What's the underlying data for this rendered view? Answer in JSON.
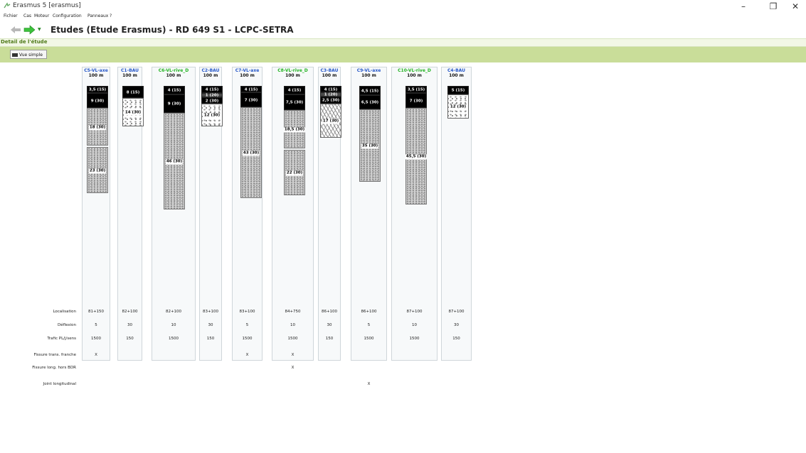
{
  "window": {
    "title": "Erasmus 5 [erasmus]",
    "controls": {
      "minimize": "–",
      "restore": "❐",
      "close": "✕"
    }
  },
  "menu": [
    "Fichier",
    "Cas",
    "Moteur",
    "Configuration",
    "Panneaux",
    "?"
  ],
  "nav": {
    "title": "Etudes (Etude Erasmus) - RD 649 S1 - LCPC-SETRA"
  },
  "section": {
    "title": "Detail de l'étude"
  },
  "toolbar": {
    "view_button": "Vue simple"
  },
  "colors": {
    "blue_name": "#2456c8",
    "green_name": "#22b322",
    "toolbar_bg": "#c9dd99"
  },
  "columns": [
    {
      "name": "C5-VL-axe",
      "name_color": "blue",
      "length": "100 m",
      "layers": [
        {
          "label": "3,5 (15)",
          "type": "black",
          "h": 10
        },
        {
          "label": "9 (30)",
          "type": "black",
          "h": 21
        },
        {
          "label": "18 (30)",
          "type": "gravel",
          "h": 53
        },
        {
          "label": "23 (30)",
          "type": "gravel",
          "h": 65
        }
      ]
    },
    {
      "name": "C1-BAU",
      "name_color": "blue",
      "length": "100 m",
      "layers": [
        {
          "label": "8 (15)",
          "type": "black",
          "h": 17
        },
        {
          "label": "14 (30)",
          "type": "white",
          "h": 40
        }
      ]
    },
    {
      "name": "C6-VL-rive_D",
      "name_color": "green",
      "length": "100 m",
      "layers": [
        {
          "label": "4 (15)",
          "type": "black",
          "h": 12
        },
        {
          "label": "9 (30)",
          "type": "black",
          "h": 26
        },
        {
          "label": "46 (30)",
          "type": "gravel",
          "h": 136
        }
      ]
    },
    {
      "name": "C2-BAU",
      "name_color": "blue",
      "length": "100 m",
      "layers": [
        {
          "label": "4 (15)",
          "type": "black",
          "h": 10
        },
        {
          "label": "1 (20)",
          "type": "dgray",
          "h": 6
        },
        {
          "label": "2 (30)",
          "type": "black",
          "h": 9
        },
        {
          "label": "12 (30)",
          "type": "white",
          "h": 32
        }
      ]
    },
    {
      "name": "C7-VL-axe",
      "name_color": "blue",
      "length": "100 m",
      "layers": [
        {
          "label": "4 (15)",
          "type": "black",
          "h": 9
        },
        {
          "label": "7 (30)",
          "type": "black",
          "h": 21
        },
        {
          "label": "43 (30)",
          "type": "gravel",
          "h": 128
        }
      ]
    },
    {
      "name": "C8-VL-rive_D",
      "name_color": "green",
      "length": "100 m",
      "layers": [
        {
          "label": "4 (15)",
          "type": "black",
          "h": 12
        },
        {
          "label": "7,5 (30)",
          "type": "black",
          "h": 22
        },
        {
          "label": "18,5 (30)",
          "type": "gravel",
          "h": 54
        },
        {
          "label": "22 (30)",
          "type": "gravel",
          "h": 64
        }
      ]
    },
    {
      "name": "C3-BAU",
      "name_color": "blue",
      "length": "100 m",
      "layers": [
        {
          "label": "4 (15)",
          "type": "black",
          "h": 9
        },
        {
          "label": "1 (20)",
          "type": "dgray",
          "h": 6
        },
        {
          "label": "2,5 (30)",
          "type": "black",
          "h": 10
        },
        {
          "label": "17 (30)",
          "type": "zig",
          "h": 48
        }
      ]
    },
    {
      "name": "C9-VL-axe",
      "name_color": "blue",
      "length": "100 m",
      "layers": [
        {
          "label": "4,5 (15)",
          "type": "black",
          "h": 13
        },
        {
          "label": "6,5 (30)",
          "type": "black",
          "h": 20
        },
        {
          "label": "35 (30)",
          "type": "gravel",
          "h": 102
        }
      ]
    },
    {
      "name": "C10-VL-rive_D",
      "name_color": "green",
      "length": "100 m",
      "layers": [
        {
          "label": "3,5 (15)",
          "type": "black",
          "h": 10
        },
        {
          "label": "7 (30)",
          "type": "black",
          "h": 21
        },
        {
          "label": "45,5 (30)",
          "type": "gravel",
          "h": 136
        }
      ]
    },
    {
      "name": "C4-BAU",
      "name_color": "blue",
      "length": "100 m",
      "layers": [
        {
          "label": "5 (15)",
          "type": "black",
          "h": 12
        },
        {
          "label": "12 (30)",
          "type": "white",
          "h": 34
        }
      ]
    }
  ],
  "properties": {
    "labels": [
      "Localisation",
      "Déflexion",
      "Trafic PL/j/sens",
      "Fissure trans. franche",
      "Fissure long. hors BDR",
      "Joint longitudinal"
    ],
    "values": [
      [
        "81+150",
        "82+100",
        "82+100",
        "83+100",
        "83+100",
        "84+750",
        "86+100",
        "86+100",
        "87+100",
        "87+100"
      ],
      [
        "5",
        "30",
        "10",
        "30",
        "5",
        "10",
        "30",
        "5",
        "10",
        "30"
      ],
      [
        "1500",
        "150",
        "1500",
        "150",
        "1500",
        "1500",
        "150",
        "1500",
        "1500",
        "150"
      ],
      [
        "X",
        "",
        "",
        "",
        "X",
        "X",
        "",
        "",
        "",
        ""
      ],
      [
        "",
        "",
        "",
        "",
        "",
        "X",
        "",
        "",
        "",
        ""
      ],
      [
        "",
        "",
        "",
        "",
        "",
        "",
        "",
        "X",
        "",
        ""
      ]
    ]
  }
}
